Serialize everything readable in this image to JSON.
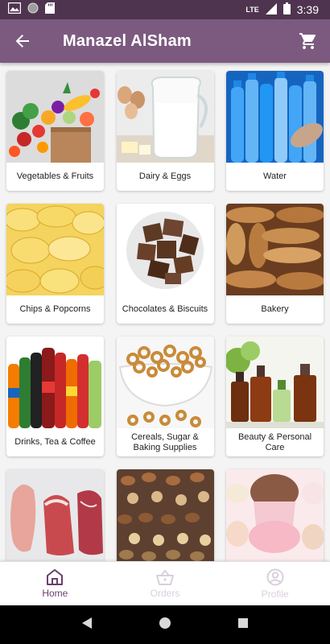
{
  "status_bar": {
    "time": "3:39",
    "network": "LTE",
    "icons": [
      "gallery-icon",
      "circle-icon",
      "sd-card-icon",
      "signal-icon",
      "battery-icon"
    ]
  },
  "app_bar": {
    "title": "Manazel AlSham",
    "back_icon": "arrow-back-icon",
    "cart_icon": "shopping-cart-icon",
    "background": "#7c5a7f",
    "status_background": "#4f3450"
  },
  "categories": [
    {
      "label": "Vegetables & Fruits",
      "image": "vegetables-fruits-image"
    },
    {
      "label": "Dairy & Eggs",
      "image": "dairy-eggs-image"
    },
    {
      "label": "Water",
      "image": "water-image"
    },
    {
      "label": "Chips & Popcorns",
      "image": "chips-image"
    },
    {
      "label": "Chocolates & Biscuits",
      "image": "chocolates-image"
    },
    {
      "label": "Bakery",
      "image": "bakery-image"
    },
    {
      "label": "Drinks, Tea & Coffee",
      "image": "drinks-image"
    },
    {
      "label": "Cereals, Sugar & Baking Supplies",
      "image": "cereals-image"
    },
    {
      "label": "Beauty & Personal Care",
      "image": "beauty-image"
    },
    {
      "label": "",
      "image": "meat-image"
    },
    {
      "label": "",
      "image": "nuts-image"
    },
    {
      "label": "",
      "image": "ice-cream-image"
    }
  ],
  "bottom_nav": {
    "items": [
      {
        "label": "Home",
        "icon": "home-icon",
        "active": true
      },
      {
        "label": "Orders",
        "icon": "basket-icon",
        "active": false
      },
      {
        "label": "Profile",
        "icon": "profile-icon",
        "active": false
      }
    ],
    "active_color": "#6b3f6e",
    "inactive_color": "#d9cfdb"
  },
  "system_nav": {
    "icons": [
      "back-triangle-icon",
      "home-circle-icon",
      "recents-square-icon"
    ]
  }
}
